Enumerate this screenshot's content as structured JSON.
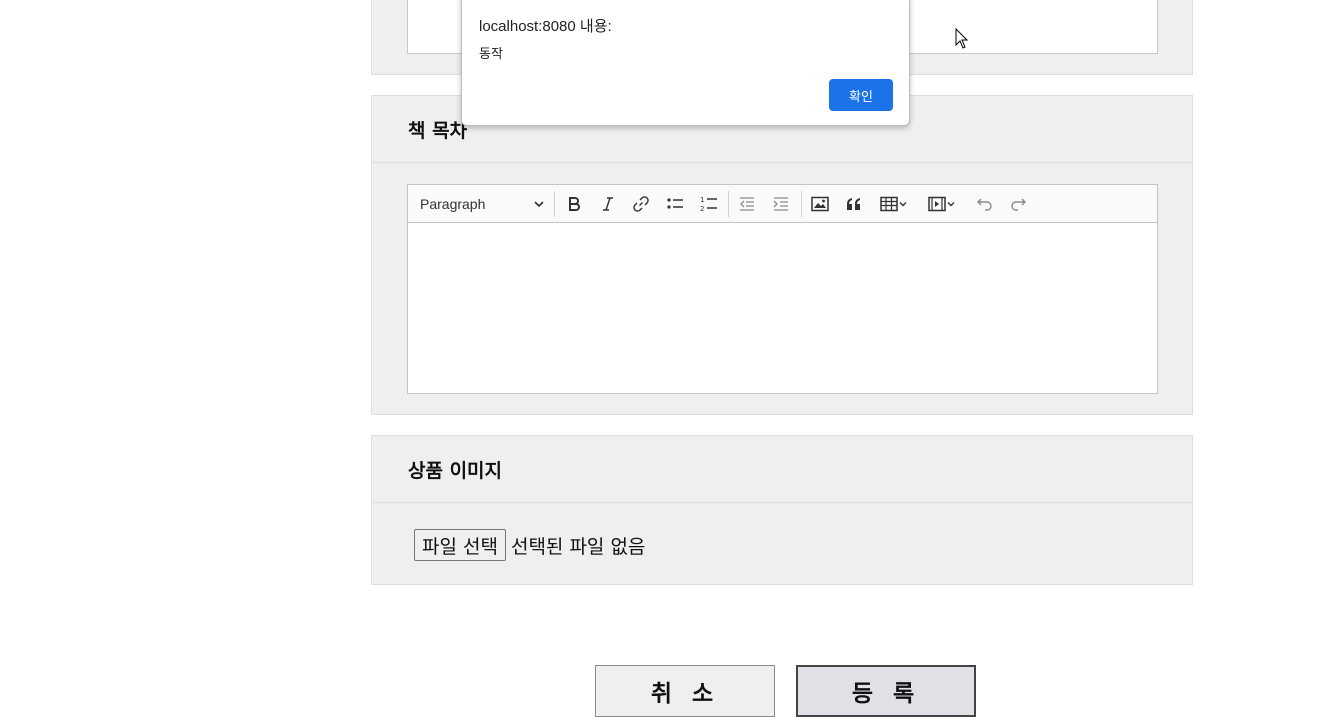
{
  "toc_section": {
    "title": "책 목차",
    "toolbar": {
      "heading_select": "Paragraph",
      "icons": [
        "bold-icon",
        "italic-icon",
        "link-icon",
        "bulleted-list-icon",
        "numbered-list-icon",
        "outdent-icon",
        "indent-icon",
        "image-icon",
        "blockquote-icon",
        "table-icon",
        "media-embed-icon",
        "undo-icon",
        "redo-icon"
      ]
    },
    "content": ""
  },
  "image_section": {
    "title": "상품 이미지",
    "file_button": "파일 선택",
    "file_status": "선택된 파일 없음"
  },
  "actions": {
    "cancel": "취 소",
    "submit": "등 록"
  },
  "alert": {
    "title": "localhost:8080 내용:",
    "message": "동작",
    "ok": "확인",
    "ok_color": "#1a73e8"
  }
}
